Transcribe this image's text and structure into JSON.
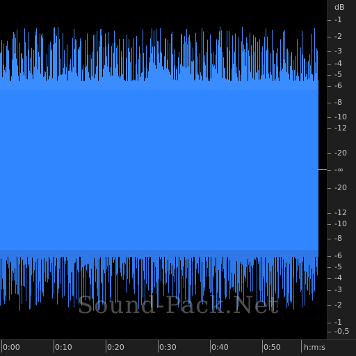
{
  "db_scale": {
    "unit": "dB",
    "labels": [
      "-1",
      "-2",
      "-3",
      "-4",
      "-5",
      "-6",
      "-8",
      "-10",
      "-12",
      "-20",
      "-∞",
      "-20",
      "-12",
      "-10",
      "-8",
      "-6",
      "-5",
      "-4",
      "-3",
      "-2",
      "-1",
      "-0,5"
    ]
  },
  "time_scale": {
    "labels": [
      "0:00",
      "0:10",
      "0:20",
      "0:30",
      "0:40",
      "0:50"
    ],
    "unit": "h:m:s"
  },
  "watermark": "Sound-Pack.Net",
  "colors": {
    "waveform": "#2f86ff",
    "background": "#000000",
    "ruler": "#1e1e1e"
  }
}
